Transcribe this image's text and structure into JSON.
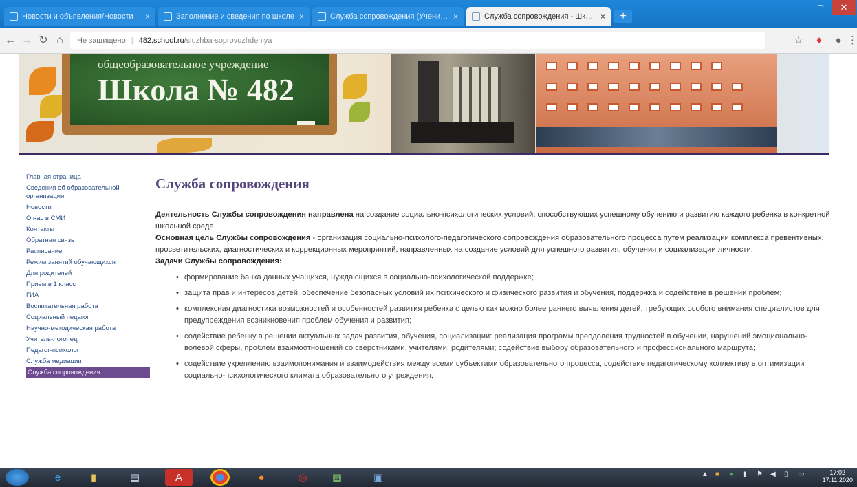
{
  "browser": {
    "tabs": [
      {
        "title": "Новости и объявления/Новости",
        "active": false
      },
      {
        "title": "Заполнение и сведения по школе",
        "active": false
      },
      {
        "title": "Служба сопровождения (Ученики)",
        "active": false
      },
      {
        "title": "Служба сопровождения - Школа",
        "active": true
      }
    ],
    "new_tab_label": "+",
    "window_controls": [
      "–",
      "□",
      "✕"
    ],
    "security_label": "Не защищено",
    "url_host": "482.school.ru",
    "url_path": "/sluzhba-soprovozhdeniya",
    "colors": {
      "tabbar": "#1573c4",
      "accent": "#3e2b66"
    }
  },
  "header": {
    "subtitle": "общеобразовательное учреждение",
    "title": "Школа № 482"
  },
  "nav": {
    "items": [
      "Главная страница",
      "Сведения об образовательной организации",
      "Новости",
      "О нас в СМИ",
      "Контакты",
      "Обратная связь",
      "Расписание",
      "Режим занятий обучающихся",
      "Для родителей",
      "Прием в 1 класс",
      "ГИА",
      "Воспитательная работа",
      "Социальный педагог",
      "Научно-методическая работа",
      "Учитель-логопед",
      "Педагог-психолог",
      "Служба медиации",
      "Служба сопровождения"
    ],
    "active_index": 17
  },
  "content": {
    "title": "Служба сопровождения",
    "intro_bold": "Деятельность Службы сопровождения направлена",
    "intro_text": " на создание социально-психологических условий, способствующих успешному обучению и развитию каждого ребенка в конкретной школьной среде.",
    "goal_bold": "Основная цель Службы сопровождения",
    "goal_text": " - организация социально-психолого-педагогического сопровождения образовательного процесса путем реализации комплекса превентивных, просветительских, диагностических и коррекционных мероприятий, направленных на создание условий для успешного развития, обучения и социализации личности.",
    "tasks_title": "Задачи Службы сопровождения:",
    "tasks": [
      "формирование банка данных учащихся, нуждающихся в социально-психологической поддержке;",
      "защита прав и интересов детей, обеспечение безопасных условий их психического и физического развития и обучения, поддержка и содействие в решении проблем;",
      "комплексная диагностика возможностей и особенностей развития ребенка с целью как можно более раннего выявления детей, требующих особого внимания специалистов для предупреждения возникновения проблем обучения и развития;",
      "содействие ребенку в решении актуальных задач развития, обучения, социализации: реализация программ преодоления трудностей в обучении, нарушений эмоционально-волевой сферы, проблем взаимоотношений со сверстниками, учителями, родителями; содействие выбору образовательного и профессионального маршрута;",
      "содействие укреплению взаимопонимания и взаимодействия между всеми субъектами образовательного процесса, содействие педагогическому коллективу в оптимизации социально-психологического климата образовательного учреждения;"
    ]
  },
  "taskbar": {
    "icons": [
      "start-orb-icon",
      "internet-explorer-icon",
      "file-explorer-icon",
      "notepad-icon",
      "acrobat-icon",
      "chrome-icon",
      "firefox-icon",
      "opera-icon",
      "spreadsheet-icon",
      "word-icon"
    ],
    "clock_time": "17:02",
    "clock_date": "17.11.2020"
  }
}
